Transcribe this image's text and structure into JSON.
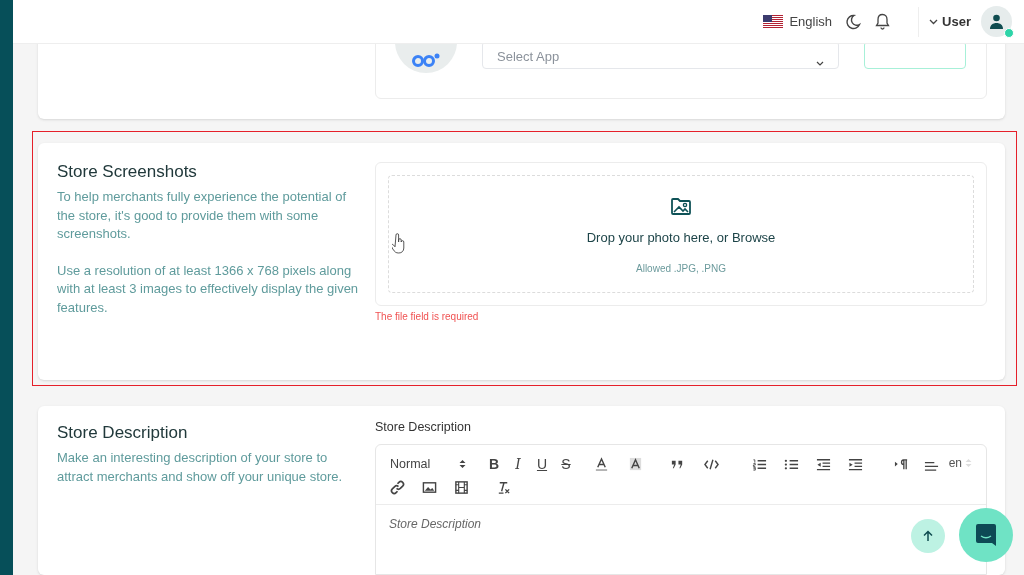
{
  "header": {
    "language": "English",
    "user": "User",
    "user_online": true
  },
  "app_card": {
    "select_placeholder": "Select App"
  },
  "screenshots": {
    "title": "Store Screenshots",
    "paragraphs": [
      "To help merchants fully experience the potential of the store, it's good to provide them with some screenshots.",
      "Use a resolution of at least 1366 x 768 pixels along with at least 3 images to effectively display the given features."
    ],
    "dropzone": {
      "text": "Drop your photo here, or Browse",
      "hint": "Allowed .JPG, .PNG"
    },
    "error": "The file field is required",
    "invalid": true
  },
  "description": {
    "title": "Store Description",
    "paragraph": "Make an interesting description of your store to attract merchants and show off your unique store.",
    "field_label": "Store Description",
    "editor": {
      "format": "Normal",
      "language": "en",
      "placeholder": "Store Description",
      "toolbar": [
        {
          "kind": "bold",
          "text": "B"
        },
        {
          "kind": "italic",
          "text": "I"
        },
        {
          "kind": "underline",
          "text": "U"
        },
        {
          "kind": "strike",
          "text": "S"
        },
        {
          "kind": "color"
        },
        {
          "kind": "background"
        },
        {
          "kind": "quote"
        },
        {
          "kind": "code"
        },
        {
          "kind": "ordered-list"
        },
        {
          "kind": "bullet-list"
        },
        {
          "kind": "outdent"
        },
        {
          "kind": "indent"
        },
        {
          "kind": "direction"
        },
        {
          "kind": "align"
        },
        {
          "kind": "break"
        },
        {
          "kind": "link"
        },
        {
          "kind": "image"
        },
        {
          "kind": "video"
        },
        {
          "kind": "clean"
        }
      ]
    }
  }
}
